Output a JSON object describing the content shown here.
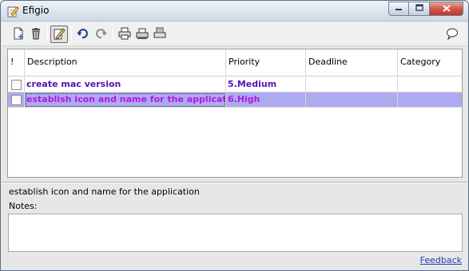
{
  "window": {
    "title": "Efigio",
    "app_icon": "notepad-pencil-icon",
    "minimize_icon": "minimize-icon",
    "maximize_icon": "maximize-icon",
    "close_icon": "close-icon"
  },
  "toolbar": {
    "buttons": [
      {
        "icon": "new-task-icon"
      },
      {
        "icon": "delete-trash-icon"
      },
      {
        "icon": "edit-pencil-icon",
        "active": true
      },
      {
        "icon": "undo-icon"
      },
      {
        "icon": "redo-icon"
      },
      {
        "icon": "print-icon"
      },
      {
        "icon": "print-preview-icon"
      },
      {
        "icon": "print-setup-icon"
      },
      {
        "icon": "help-bubble-icon"
      }
    ]
  },
  "grid": {
    "columns": [
      "!",
      "Description",
      "Priority",
      "Deadline",
      "Category"
    ],
    "rows": [
      {
        "checked": false,
        "description": "create mac version",
        "priority": "5.Medium",
        "deadline": "",
        "category": ""
      },
      {
        "checked": false,
        "description": "establish icon and name for the application",
        "priority": "6.High",
        "deadline": "",
        "category": "",
        "selected": true
      }
    ]
  },
  "detail": {
    "description": "establish icon and name for the application",
    "notes_label": "Notes:",
    "notes_value": ""
  },
  "footer": {
    "feedback_link": "Feedback"
  },
  "colors": {
    "selected_row": "#aeaaf0",
    "priority_medium_text": "#5a10b0",
    "priority_high_text": "#b01ae0",
    "link": "#1a3fb0"
  }
}
